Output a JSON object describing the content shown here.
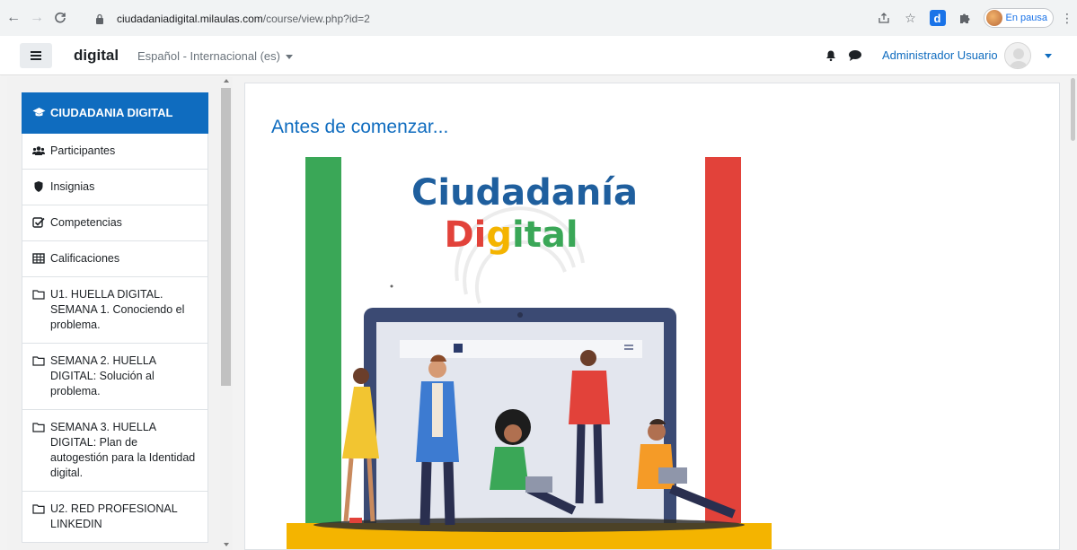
{
  "browser": {
    "url_host": "ciudadaniadigital.milaulas.com",
    "url_path": "/course/view.php?id=2",
    "profile_status": "En pausa"
  },
  "navbar": {
    "brand": "digital",
    "language": "Español - Internacional (es)",
    "user_name": "Administrador Usuario"
  },
  "drawer": {
    "items": [
      {
        "label": "CIUDADANIA DIGITAL",
        "icon": "graduation-cap-icon"
      },
      {
        "label": "Participantes",
        "icon": "users-icon"
      },
      {
        "label": "Insignias",
        "icon": "shield-icon"
      },
      {
        "label": "Competencias",
        "icon": "checkbox-icon"
      },
      {
        "label": "Calificaciones",
        "icon": "table-icon"
      },
      {
        "label": "U1. HUELLA DIGITAL. SEMANA 1. Conociendo el problema.",
        "icon": "folder-icon"
      },
      {
        "label": "SEMANA 2. HUELLA DIGITAL: Solución al problema.",
        "icon": "folder-icon"
      },
      {
        "label": "SEMANA 3. HUELLA DIGITAL: Plan de autogestión para la Identidad digital.",
        "icon": "folder-icon"
      },
      {
        "label": "U2. RED PROFESIONAL LINKEDIN",
        "icon": "folder-icon"
      }
    ]
  },
  "main": {
    "section_title": "Antes de comenzar...",
    "poster": {
      "title_line1": "Ciudadanía",
      "title_line2_part1": "Di",
      "title_line2_part2": "g",
      "title_line2_part3": "ital"
    }
  },
  "colors": {
    "moodle_blue": "#0f6cbf",
    "poster_green": "#3aa757",
    "poster_red": "#e2423a",
    "poster_yellow": "#f4b400"
  }
}
